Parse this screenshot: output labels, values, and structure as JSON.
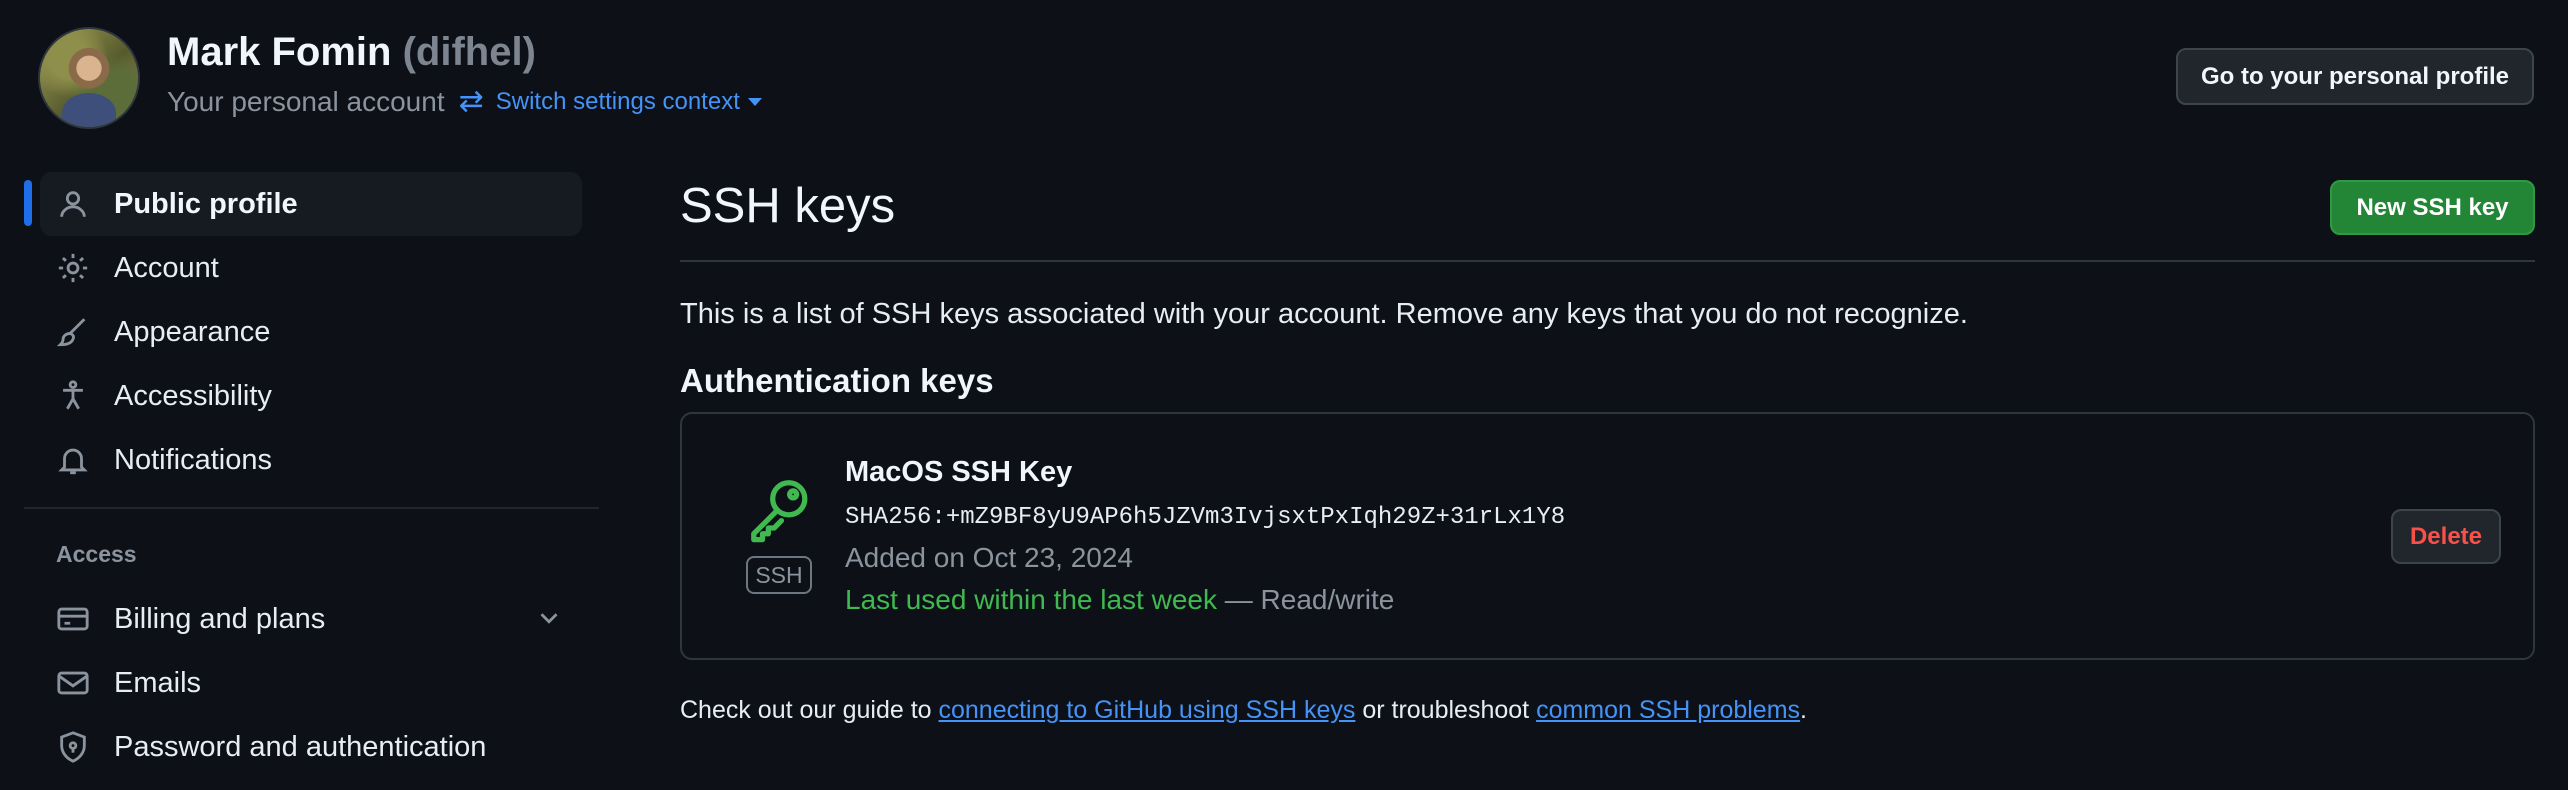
{
  "header": {
    "name": "Mark Fomin",
    "login": "(difhel)",
    "subtitle": "Your personal account",
    "switch_label": "Switch settings context",
    "profile_button": "Go to your personal profile"
  },
  "sidebar": {
    "items": [
      {
        "label": "Public profile",
        "icon": "person-icon",
        "active": true
      },
      {
        "label": "Account",
        "icon": "gear-icon"
      },
      {
        "label": "Appearance",
        "icon": "paintbrush-icon"
      },
      {
        "label": "Accessibility",
        "icon": "accessibility-icon"
      },
      {
        "label": "Notifications",
        "icon": "bell-icon"
      }
    ],
    "access_heading": "Access",
    "access_items": [
      {
        "label": "Billing and plans",
        "icon": "credit-card-icon",
        "expandable": true
      },
      {
        "label": "Emails",
        "icon": "mail-icon"
      },
      {
        "label": "Password and authentication",
        "icon": "shield-lock-icon"
      }
    ]
  },
  "main": {
    "title": "SSH keys",
    "new_button": "New SSH key",
    "intro": "This is a list of SSH keys associated with your account. Remove any keys that you do not recognize.",
    "section_title": "Authentication keys",
    "key": {
      "icon": "key-icon",
      "badge": "SSH",
      "title": "MacOS SSH Key",
      "fingerprint": "SHA256:+mZ9BF8yU9AP6h5JZVm3IvjsxtPxIqh29Z+31rLx1Y8",
      "added": "Added on Oct 23, 2024",
      "last_used": "Last used within the last week",
      "access": " — Read/write",
      "delete_button": "Delete"
    },
    "footer": {
      "prefix": "Check out our guide to ",
      "link1": "connecting to GitHub using SSH keys",
      "middle": " or troubleshoot ",
      "link2": "common SSH problems",
      "suffix": "."
    }
  },
  "colors": {
    "background": "#0d1117",
    "accent_blue": "#4493f8",
    "success_green": "#3fb950",
    "danger_red": "#f85149",
    "primary_button": "#238636"
  }
}
